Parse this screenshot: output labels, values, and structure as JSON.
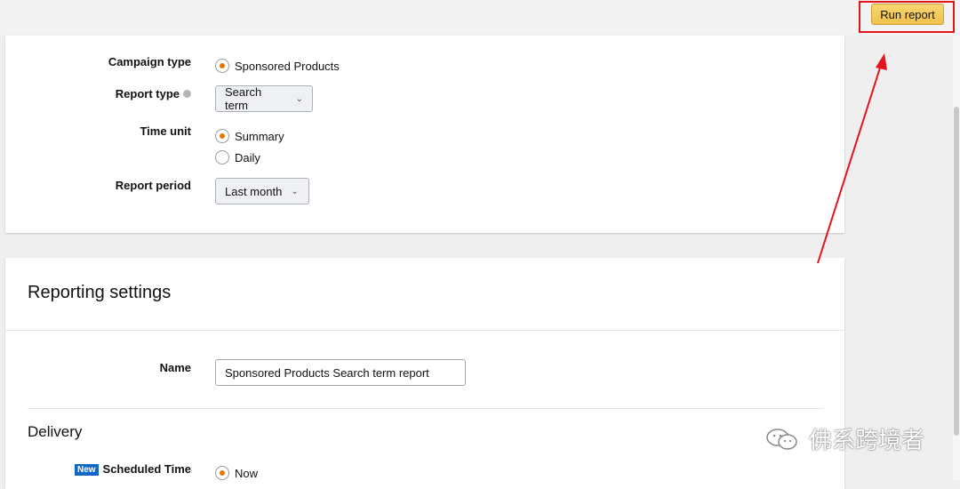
{
  "toolbar": {
    "run_report_label": "Run report"
  },
  "report_config": {
    "campaign_type": {
      "label": "Campaign type",
      "value": "Sponsored Products"
    },
    "report_type": {
      "label": "Report type",
      "value": "Search term"
    },
    "time_unit": {
      "label": "Time unit",
      "options": [
        "Summary",
        "Daily"
      ],
      "selected": "Summary"
    },
    "report_period": {
      "label": "Report period",
      "value": "Last month"
    }
  },
  "reporting_settings": {
    "title": "Reporting settings",
    "name": {
      "label": "Name",
      "value": "Sponsored Products Search term report"
    }
  },
  "delivery": {
    "title": "Delivery",
    "scheduled_time": {
      "badge": "New",
      "label": "Scheduled Time",
      "value": "Now"
    }
  },
  "watermark": {
    "text": "佛系跨境者",
    "icon": "wechat-icon"
  },
  "colors": {
    "accent_orange": "#e77600",
    "button_yellow": "#f0c14b",
    "highlight_red": "#e3141c",
    "badge_blue": "#1168c4"
  }
}
